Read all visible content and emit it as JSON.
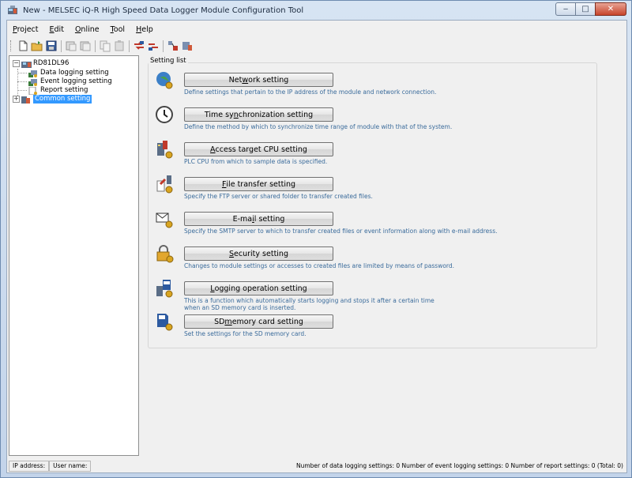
{
  "window": {
    "title": "New - MELSEC iQ-R High Speed Data Logger Module Configuration Tool",
    "minimize": "‒",
    "maximize": "□",
    "close": "✕"
  },
  "menubar": [
    {
      "pre": "",
      "u": "P",
      "post": "roject"
    },
    {
      "pre": "",
      "u": "E",
      "post": "dit"
    },
    {
      "pre": "",
      "u": "O",
      "post": "nline"
    },
    {
      "pre": "",
      "u": "T",
      "post": "ool"
    },
    {
      "pre": "",
      "u": "H",
      "post": "elp"
    }
  ],
  "tree": {
    "root": "RD81DL96",
    "items": [
      "Data logging setting",
      "Event logging setting",
      "Report setting",
      "Common setting"
    ],
    "expand_symbol": "−",
    "collapse_symbol": "+"
  },
  "settings": {
    "group_label": "Setting list",
    "rows": [
      {
        "pre": "Net",
        "u": "w",
        "post": "ork setting",
        "desc": "Define settings that pertain to the IP address of the module and network connection.",
        "icon": "network-icon"
      },
      {
        "pre": "Time sy",
        "u": "n",
        "post": "chronization setting",
        "desc": "Define the method by which to synchronize time range of module with that of the system.",
        "icon": "clock-icon"
      },
      {
        "pre": "",
        "u": "A",
        "post": "ccess target CPU setting",
        "desc": "PLC CPU from which to sample data is specified.",
        "icon": "cpu-icon"
      },
      {
        "pre": "",
        "u": "F",
        "post": "ile transfer setting",
        "desc": "Specify the FTP server or shared folder to transfer created files.",
        "icon": "file-transfer-icon"
      },
      {
        "pre": "E-ma",
        "u": "i",
        "post": "l setting",
        "desc": "Specify the SMTP server to which to transfer created files or event information along with e-mail address.",
        "icon": "email-icon"
      },
      {
        "pre": "",
        "u": "S",
        "post": "ecurity setting",
        "desc": "Changes to module settings or accesses to created files are limited by means of password.",
        "icon": "lock-icon"
      },
      {
        "pre": "",
        "u": "L",
        "post": "ogging operation setting",
        "desc": "This is a function which automatically starts logging and stops it after a certain time",
        "desc2": "when an SD memory card is inserted.",
        "icon": "logging-operation-icon"
      },
      {
        "pre": "SD ",
        "u": "m",
        "post": "emory card setting",
        "desc": "Set the settings for the SD memory card.",
        "icon": "sd-card-icon"
      }
    ]
  },
  "statusbar": {
    "ip_label": "IP address:",
    "user_label": "User name:",
    "summary": "Number of data logging settings: 0  Number of event logging settings: 0  Number of report settings: 0  (Total: 0)"
  },
  "colors": {
    "selection": "#3399ff",
    "description_text": "#3a6b9b"
  }
}
